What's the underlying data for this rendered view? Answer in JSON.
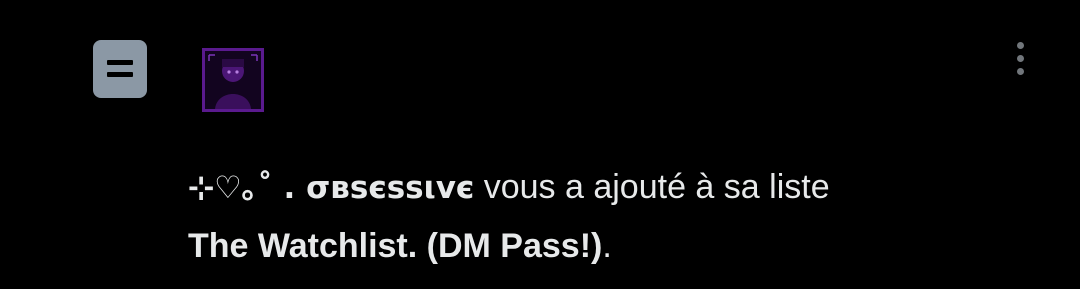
{
  "notification": {
    "user_name": "⊹♡｡˚ . σвѕєѕѕιvє",
    "action_text": " vous a ajouté à sa liste",
    "list_name": "The Watchlist. (DM Pass!)",
    "list_name_suffix": "."
  },
  "icons": {
    "type_icon": "list-icon",
    "menu_icon": "more-vertical-icon"
  },
  "colors": {
    "background": "#000000",
    "text": "#e7e9ea",
    "icon_box": "#8b98a5",
    "avatar_border": "#5a1a8e",
    "menu_dots": "#71767b"
  }
}
